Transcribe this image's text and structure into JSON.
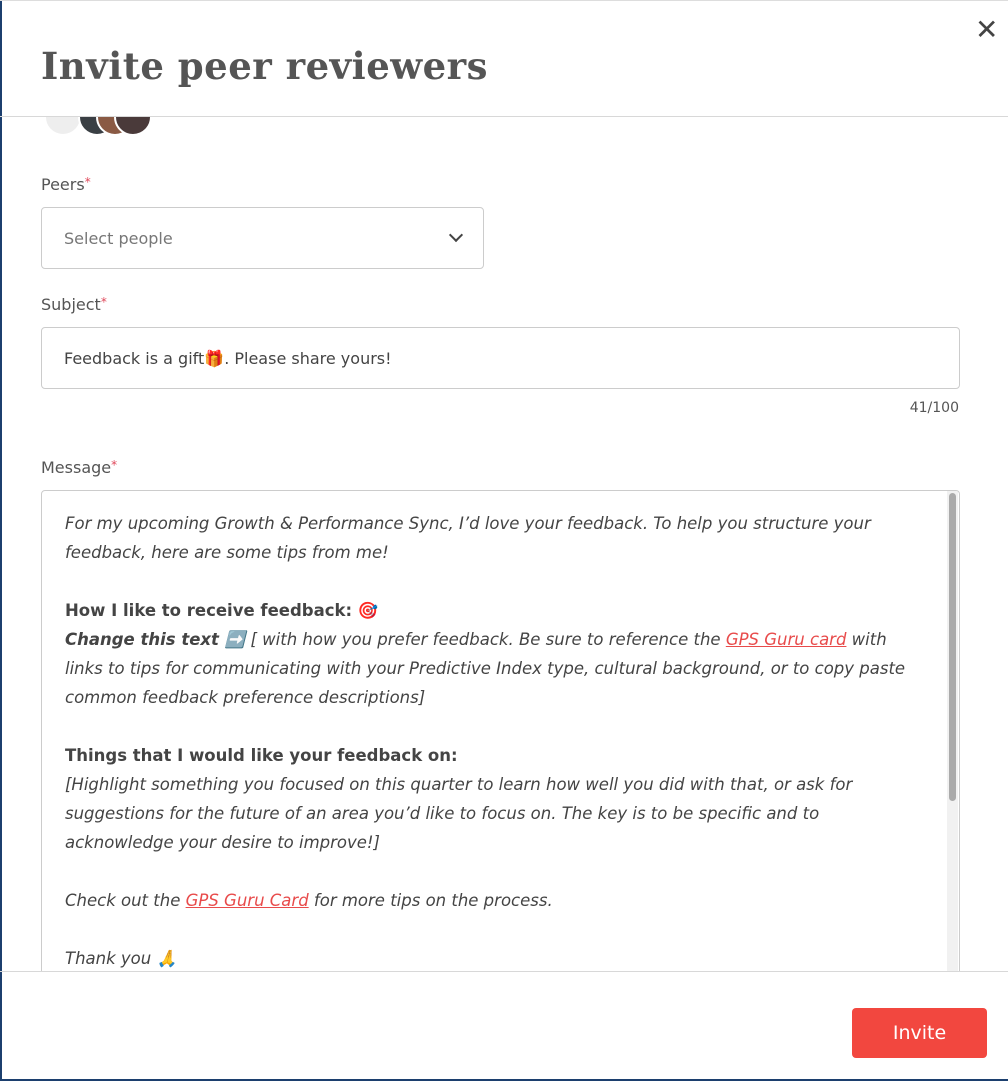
{
  "modal": {
    "title": "Invite peer reviewers",
    "close_icon": "close-icon"
  },
  "peers": {
    "label": "Peers",
    "required": "*",
    "placeholder": "Select people"
  },
  "subject": {
    "label": "Subject",
    "required": "*",
    "value": "Feedback is a gift🎁. Please share yours!",
    "counter": "41/100"
  },
  "message": {
    "label": "Message",
    "required": "*",
    "line1": "For my upcoming Growth & Performance Sync, I’d love your feedback. To help you structure your feedback, here are some tips from me!",
    "h1": "How I like to receive feedback: 🎯",
    "change_bold": "Change this text ➡️",
    "change_rest": "[ with how you prefer feedback. Be sure to reference the ",
    "link1": "GPS Guru card",
    "change_end": " with links to tips for communicating with your Predictive Index type, cultural background, or to copy paste common feedback preference descriptions]",
    "h2": "Things that I would like your feedback on:",
    "highlight": "[Highlight something you focused on this quarter to learn how well you did with that, or ask for suggestions for the future of an area you’d like to focus on. The key is to be specific and to acknowledge your desire to improve!]",
    "check_pre": "Check out the ",
    "link2": "GPS Guru Card",
    "check_post": " for more tips on the process.",
    "thanks": "Thank you 🙏"
  },
  "footer": {
    "invite_label": "Invite"
  },
  "colors": {
    "accent": "#f2473f",
    "link": "#e84b4b"
  }
}
